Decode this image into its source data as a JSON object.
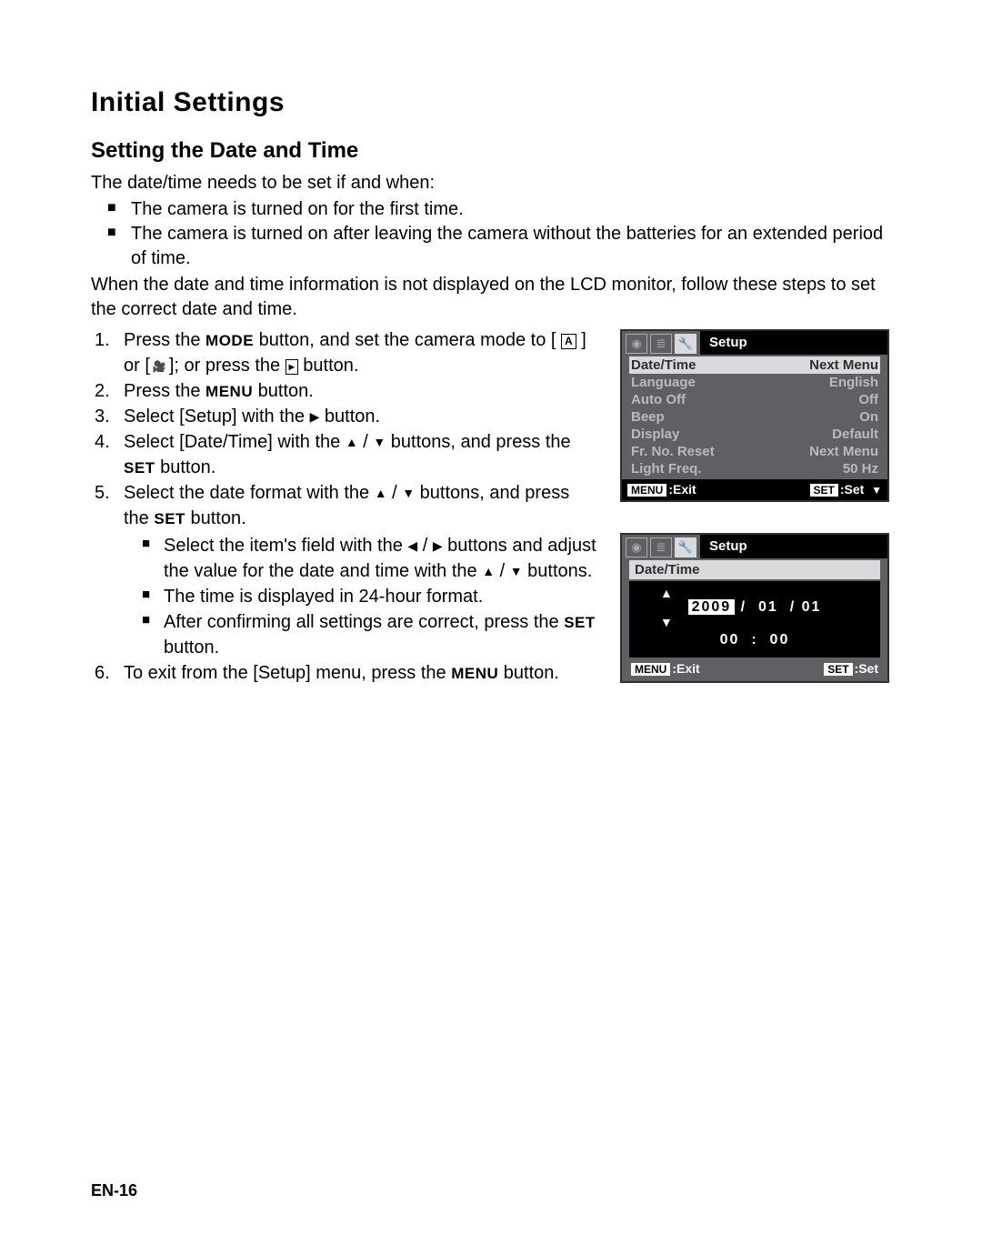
{
  "title": "Initial Settings",
  "subtitle": "Setting the Date and Time",
  "intro": "The date/time needs to be set if and when:",
  "bullets": [
    "The camera is turned on for the first time.",
    "The camera is turned on after leaving the camera without the batteries for an extended period of time."
  ],
  "when": "When the date and time information is not displayed on the LCD monitor, follow these steps to set the correct date and time.",
  "steps": {
    "s1a": "Press the ",
    "s1_mode": "MODE",
    "s1b": " button, and set the camera mode to [ ",
    "s1c": " ] or [",
    "s1d": "]; or press the ",
    "s1e": " button.",
    "s2a": "Press the ",
    "s2_menu": "MENU",
    "s2b": " button.",
    "s3a": "Select [Setup] with the ",
    "s3b": " button.",
    "s4a": "Select [Date/Time] with the ",
    "s4b": " buttons, and press the ",
    "s4_set": "SET",
    "s4c": " button.",
    "s5a": "Select the date format with the ",
    "s5b": " buttons, and press the ",
    "s5_set": "SET",
    "s5c": " button.",
    "sub1a": "Select the item's field with the ",
    "sub1b": " buttons and adjust the value for the date and time with the ",
    "sub1c": " buttons.",
    "sub2": "The time is displayed in 24-hour format.",
    "sub3a": "After confirming all settings are correct, press the ",
    "sub3_set": "SET",
    "sub3b": " button.",
    "s6a": "To exit from the [Setup] menu, press the ",
    "s6_menu": "MENU",
    "s6b": " button."
  },
  "lcd1": {
    "title": "Setup",
    "rows": [
      {
        "l": "Date/Time",
        "r": "Next Menu"
      },
      {
        "l": "Language",
        "r": "English"
      },
      {
        "l": "Auto Off",
        "r": "Off"
      },
      {
        "l": "Beep",
        "r": "On"
      },
      {
        "l": "Display",
        "r": "Default"
      },
      {
        "l": "Fr. No. Reset",
        "r": "Next Menu"
      },
      {
        "l": "Light Freq.",
        "r": "50 Hz"
      }
    ],
    "footer": {
      "menu": "MENU",
      "exit": ":Exit",
      "set": "SET",
      "setl": ":Set"
    }
  },
  "lcd2": {
    "title": "Setup",
    "head": "Date/Time",
    "year": "2009",
    "sep": "/",
    "month": "01",
    "day": "01",
    "hour": "00",
    "colon": ":",
    "min": "00",
    "footer": {
      "menu": "MENU",
      "exit": ":Exit",
      "set": "SET",
      "setl": ":Set"
    }
  },
  "pagenum": "EN-16"
}
